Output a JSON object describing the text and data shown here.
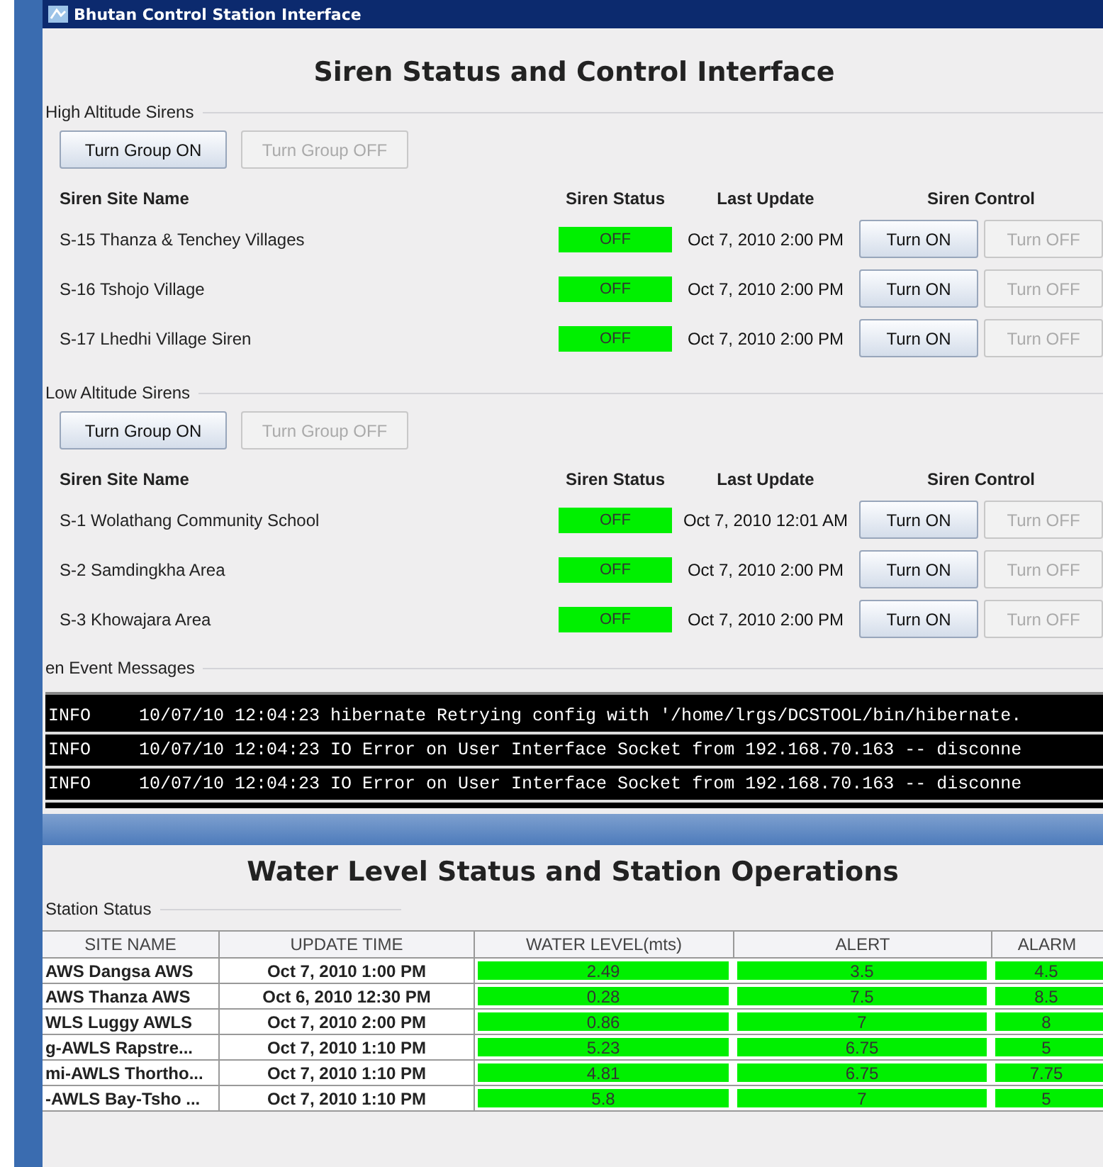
{
  "window": {
    "title": "Bhutan Control Station Interface"
  },
  "header": "Siren Status and Control Interface",
  "groups": [
    {
      "title": "High Altitude Sirens",
      "buttons": [
        {
          "label": "Turn Group ON",
          "disabled": false
        },
        {
          "label": "Turn Group OFF",
          "disabled": true
        }
      ],
      "columns": [
        "Siren Site Name",
        "Siren Status",
        "Last Update",
        "Siren Control"
      ],
      "rows": [
        {
          "site": "S-15 Thanza & Tenchey Villages",
          "status": "OFF",
          "last_update": "Oct 7, 2010 2:00 PM",
          "buttons": [
            {
              "label": "Turn ON",
              "disabled": false
            },
            {
              "label": "Turn OFF",
              "disabled": true
            }
          ]
        },
        {
          "site": "S-16 Tshojo Village",
          "status": "OFF",
          "last_update": "Oct 7, 2010 2:00 PM",
          "buttons": [
            {
              "label": "Turn ON",
              "disabled": false
            },
            {
              "label": "Turn OFF",
              "disabled": true
            }
          ]
        },
        {
          "site": "S-17 Lhedhi Village Siren",
          "status": "OFF",
          "last_update": "Oct 7, 2010 2:00 PM",
          "buttons": [
            {
              "label": "Turn ON",
              "disabled": false
            },
            {
              "label": "Turn OFF",
              "disabled": true
            }
          ]
        }
      ]
    },
    {
      "title": "Low Altitude Sirens",
      "buttons": [
        {
          "label": "Turn Group ON",
          "disabled": false
        },
        {
          "label": "Turn Group OFF",
          "disabled": true
        }
      ],
      "columns": [
        "Siren Site Name",
        "Siren Status",
        "Last Update",
        "Siren Control"
      ],
      "rows": [
        {
          "site": "S-1 Wolathang Community School",
          "status": "OFF",
          "last_update": "Oct 7, 2010 12:01 AM",
          "buttons": [
            {
              "label": "Turn ON",
              "disabled": false
            },
            {
              "label": "Turn OFF",
              "disabled": true
            }
          ]
        },
        {
          "site": "S-2 Samdingkha Area",
          "status": "OFF",
          "last_update": "Oct 7, 2010 2:00 PM",
          "buttons": [
            {
              "label": "Turn ON",
              "disabled": false
            },
            {
              "label": "Turn OFF",
              "disabled": true
            }
          ]
        },
        {
          "site": "S-3 Khowajara Area",
          "status": "OFF",
          "last_update": "Oct 7, 2010 2:00 PM",
          "buttons": [
            {
              "label": "Turn ON",
              "disabled": false
            },
            {
              "label": "Turn OFF",
              "disabled": true
            }
          ]
        }
      ]
    }
  ],
  "events": {
    "title": "en Event Messages",
    "messages": [
      {
        "level": "INFO",
        "text": "10/07/10 12:04:23 hibernate Retrying config with '/home/lrgs/DCSTOOL/bin/hibernate."
      },
      {
        "level": "INFO",
        "text": "10/07/10 12:04:23 IO Error on User Interface Socket from 192.168.70.163 -- disconne"
      },
      {
        "level": "INFO",
        "text": "10/07/10 12:04:23 IO Error on User Interface Socket from 192.168.70.163 -- disconne"
      }
    ]
  },
  "water": {
    "title": "Water Level Status and Station Operations",
    "table": {
      "title": "Station Status",
      "columns": [
        "SITE NAME",
        "UPDATE TIME",
        "WATER LEVEL(mts)",
        "ALERT",
        "ALARM"
      ],
      "rows": [
        [
          "AWS Dangsa AWS",
          "Oct 7, 2010 1:00 PM",
          "2.49",
          "3.5",
          "4.5"
        ],
        [
          "AWS Thanza AWS",
          "Oct 6, 2010 12:30 PM",
          "0.28",
          "7.5",
          "8.5"
        ],
        [
          "WLS Luggy AWLS",
          "Oct 7, 2010 2:00 PM",
          "0.86",
          "7",
          "8"
        ],
        [
          "g-AWLS Rapstre...",
          "Oct 7, 2010 1:10 PM",
          "5.23",
          "6.75",
          "5"
        ],
        [
          "mi-AWLS Thortho...",
          "Oct 7, 2010 1:10 PM",
          "4.81",
          "6.75",
          "7.75"
        ],
        [
          "-AWLS Bay-Tsho ...",
          "Oct 7, 2010 1:10 PM",
          "5.8",
          "7",
          "5"
        ]
      ]
    }
  }
}
